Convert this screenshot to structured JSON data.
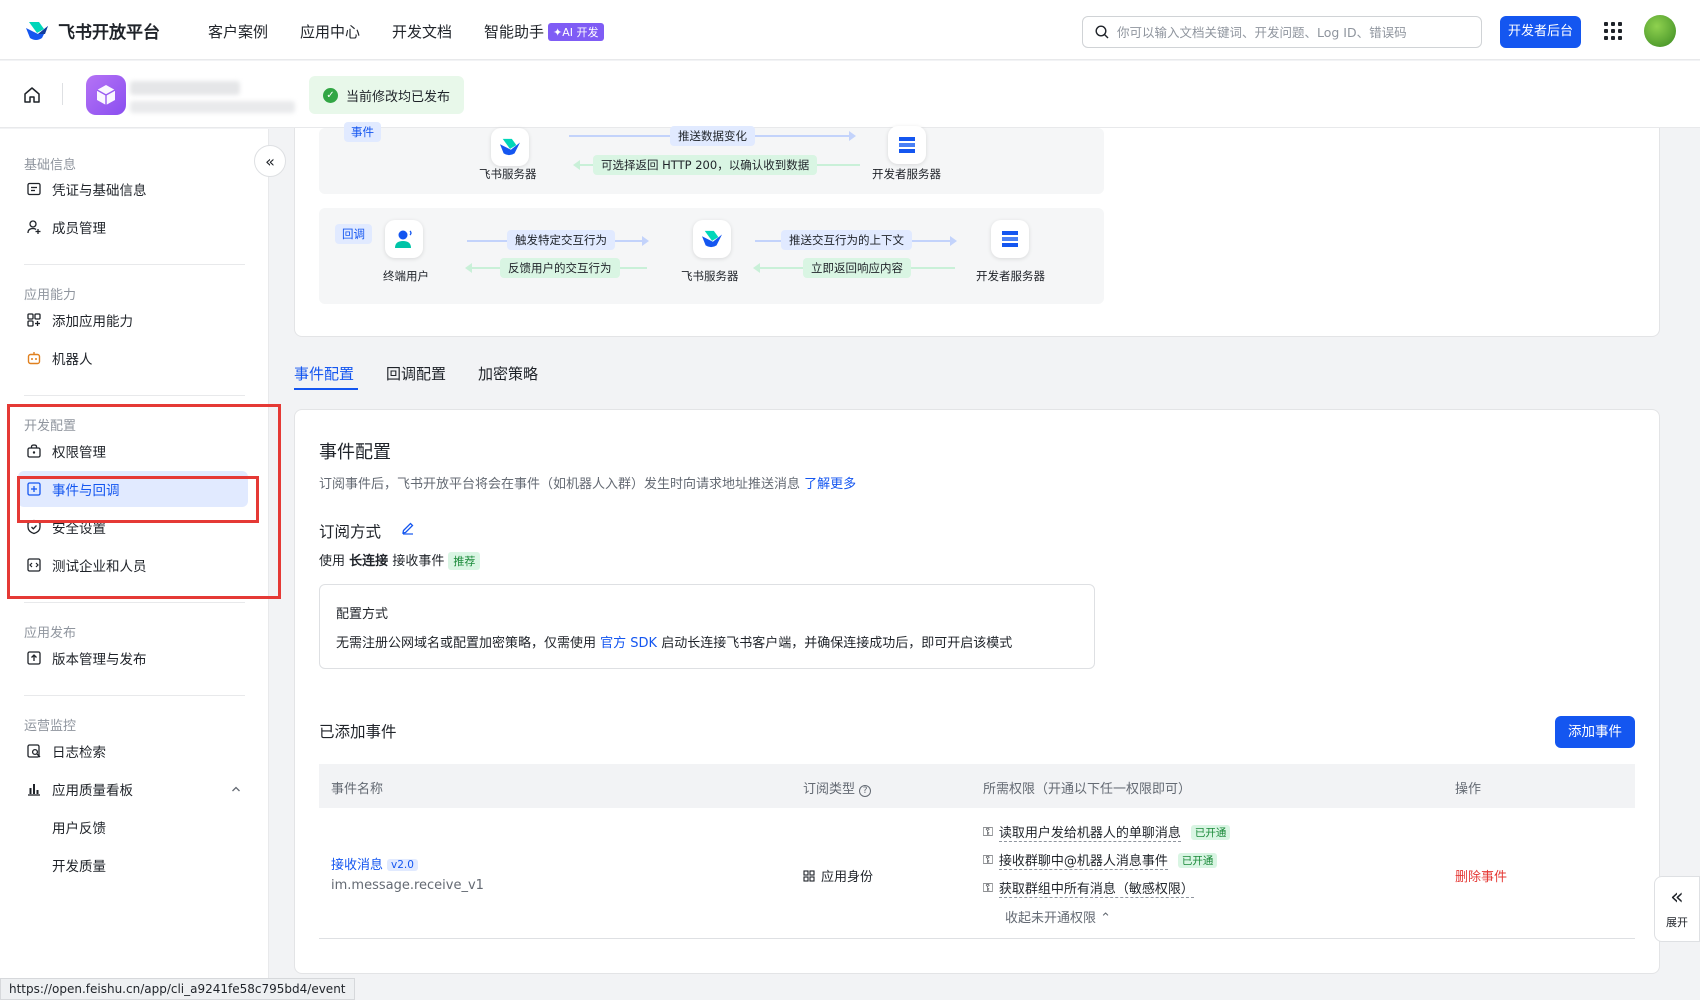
{
  "nav": {
    "logo_text": "飞书开放平台",
    "links": [
      "客户案例",
      "应用中心",
      "开发文档",
      "智能助手"
    ],
    "ai_badge": "✦AI 开发",
    "search_placeholder": "你可以输入文档关键词、开发问题、Log ID、错误码",
    "dev_console_btn": "开发者后台"
  },
  "subheader": {
    "publish_status": "当前修改均已发布"
  },
  "sidebar": {
    "groups": [
      {
        "title": "基础信息",
        "items": [
          "凭证与基础信息",
          "成员管理"
        ]
      },
      {
        "title": "应用能力",
        "items": [
          "添加应用能力",
          "机器人"
        ]
      },
      {
        "title": "开发配置",
        "items": [
          "权限管理",
          "事件与回调",
          "安全设置",
          "测试企业和人员"
        ]
      },
      {
        "title": "应用发布",
        "items": [
          "版本管理与发布"
        ]
      },
      {
        "title": "运营监控",
        "items": [
          "日志检索",
          "应用质量看板",
          "用户反馈",
          "开发质量"
        ]
      }
    ],
    "active_item": "事件与回调"
  },
  "flow": {
    "event_tag": "事件",
    "callback_tag": "回调",
    "feishu_server": "飞书服务器",
    "dev_server": "开发者服务器",
    "end_user": "终端用户",
    "push_data_change": "推送数据变化",
    "return_http": "可选择返回 HTTP 200，以确认收到数据",
    "trigger_action": "触发特定交互行为",
    "feedback_action": "反馈用户的交互行为",
    "push_context": "推送交互行为的上下文",
    "return_response": "立即返回响应内容"
  },
  "tabs": [
    "事件配置",
    "回调配置",
    "加密策略"
  ],
  "event_config": {
    "title": "事件配置",
    "desc": "订阅事件后，飞书开放平台将会在事件（如机器人入群）发生时向请求地址推送消息",
    "learn_more": "了解更多",
    "subscribe_title": "订阅方式",
    "subscribe_prefix": "使用",
    "subscribe_bold": "长连接",
    "subscribe_suffix": "接收事件",
    "recommended": "推荐",
    "config_title": "配置方式",
    "config_desc_prefix": "无需注册公网域名或配置加密策略，仅需使用",
    "config_link": "官方 SDK",
    "config_desc_suffix": "启动长连接飞书客户端，并确保连接成功后，即可开启该模式"
  },
  "events": {
    "title": "已添加事件",
    "add_btn": "添加事件",
    "headers": [
      "事件名称",
      "订阅类型",
      "所需权限（开通以下任一权限即可）",
      "操作"
    ],
    "rows": [
      {
        "name": "接收消息",
        "version": "v2.0",
        "code": "im.message.receive_v1",
        "type": "应用身份",
        "permissions": [
          {
            "name": "读取用户发给机器人的单聊消息",
            "status": "已开通"
          },
          {
            "name": "接收群聊中@机器人消息事件",
            "status": "已开通"
          },
          {
            "name": "获取群组中所有消息（敏感权限）",
            "status": ""
          }
        ],
        "collapse_text": "收起未开通权限",
        "action": "删除事件"
      }
    ]
  },
  "status_url": "https://open.feishu.cn/app/cli_a9241fe58c795bd4/event",
  "expand_label": "展开",
  "colors": {
    "primary": "#1456f0",
    "danger": "#e53935",
    "success": "#32a645"
  }
}
